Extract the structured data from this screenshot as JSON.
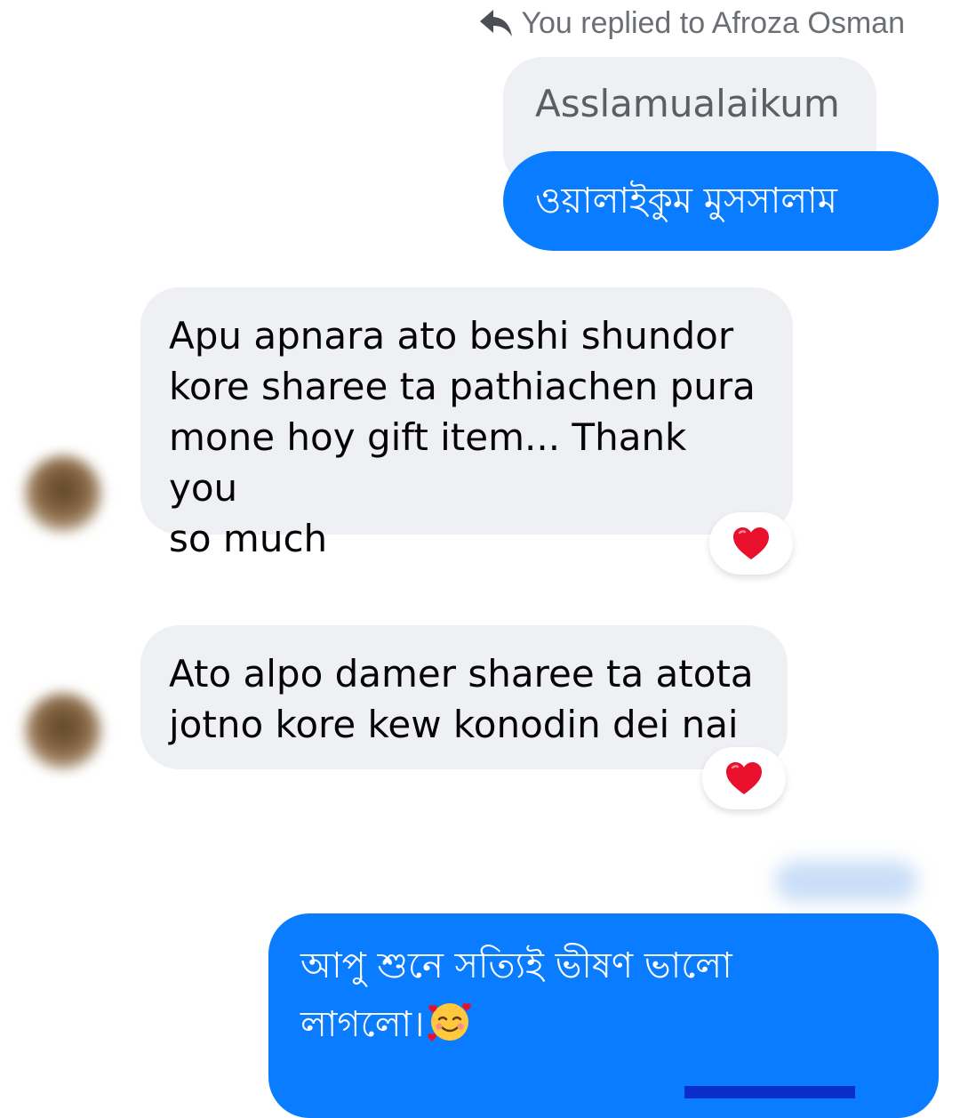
{
  "reply_context": {
    "label": "You replied to Afroza Osman",
    "icon": "reply-arrow-icon"
  },
  "quoted_message": {
    "text": "Asslamualaikum"
  },
  "reply_message": {
    "text": "ওয়ালাইকুম মুসসালাম"
  },
  "messages": [
    {
      "text": "Apu apnara ato beshi shundor kore sharee ta pathiachen pura mone hoy gift item... Thank you so much",
      "lines": [
        "Apu apnara ato beshi shundor",
        "kore sharee ta pathiachen pura",
        "mone hoy gift item... Thank you",
        "so much"
      ],
      "reaction": "red-heart-icon"
    },
    {
      "text": "Ato alpo damer sharee ta atota jotno kore kew konodin dei nai",
      "lines": [
        "Ato alpo damer sharee ta atota",
        "jotno kore kew konodin dei nai"
      ],
      "reaction": "red-heart-icon"
    }
  ],
  "last_message": {
    "lines": [
      "আপু শুনে সত্যিই ভীষণ ভালো",
      "লাগলো।"
    ],
    "emoji": "smiling-face-with-hearts-icon"
  },
  "colors": {
    "outgoing_bubble": "#0a7cff",
    "incoming_bubble": "#eef0f4",
    "quoted_text": "#5b5e63",
    "reply_header_text": "#6b6f75",
    "heart": "#e8102c"
  }
}
